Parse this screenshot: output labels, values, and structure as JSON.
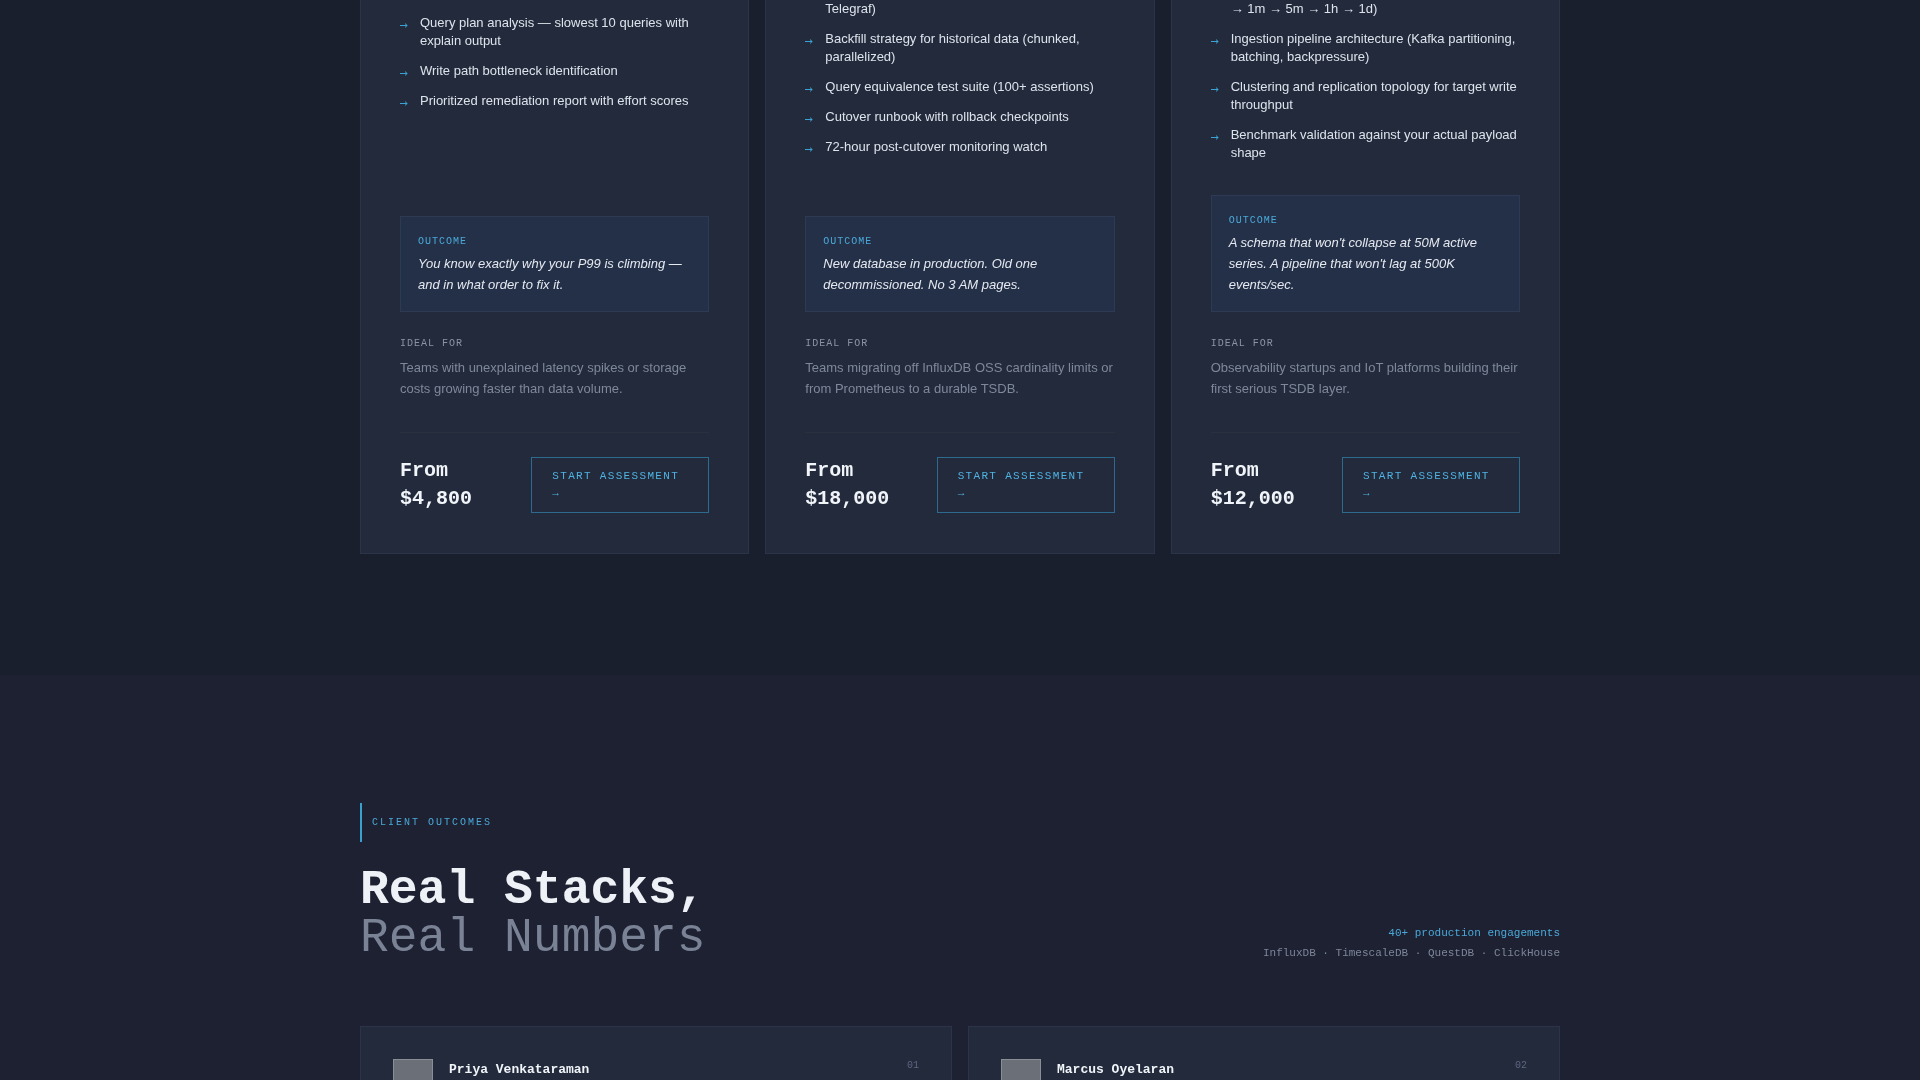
{
  "pricing_cards": [
    {
      "deliverables": [
        "Query plan analysis — slowest 10 queries with explain output",
        "Write path bottleneck identification",
        "Prioritized remediation report with effort scores"
      ],
      "outcome": {
        "label": "OUTCOME",
        "text": "You know exactly why your P99 is climbing — and in what order to fix it."
      },
      "ideal_for": {
        "label": "IDEAL FOR",
        "text": "Teams with unexplained latency spikes or storage costs growing faster than data volume."
      },
      "price": {
        "prefix": "From",
        "amount": "$4,800"
      },
      "button": "START ASSESSMENT →"
    },
    {
      "top_fragment": "Telegraf)",
      "deliverables": [
        "Backfill strategy for historical data (chunked, parallelized)",
        "Query equivalence test suite (100+ assertions)",
        "Cutover runbook with rollback checkpoints",
        "72-hour post-cutover monitoring watch"
      ],
      "outcome": {
        "label": "OUTCOME",
        "text": "New database in production. Old one decommissioned. No 3 AM pages."
      },
      "ideal_for": {
        "label": "IDEAL FOR",
        "text": "Teams migrating off InfluxDB OSS cardinality limits or from Prometheus to a durable TSDB."
      },
      "price": {
        "prefix": "From",
        "amount": "$18,000"
      },
      "button": "START ASSESSMENT →"
    },
    {
      "top_fragment": "→ 1m → 5m → 1h → 1d)",
      "deliverables": [
        "Ingestion pipeline architecture (Kafka partitioning, batching, backpressure)",
        "Clustering and replication topology for target write throughput",
        "Benchmark validation against your actual payload shape"
      ],
      "outcome": {
        "label": "OUTCOME",
        "text": "A schema that won't collapse at 50M active series. A pipeline that won't lag at 500K events/sec."
      },
      "ideal_for": {
        "label": "IDEAL FOR",
        "text": "Observability startups and IoT platforms building their first serious TSDB layer."
      },
      "price": {
        "prefix": "From",
        "amount": "$12,000"
      },
      "button": "START ASSESSMENT →"
    }
  ],
  "client_outcomes": {
    "eyebrow": "CLIENT OUTCOMES",
    "title": {
      "line_1": "Real Stacks,",
      "line_2": "Real Numbers"
    },
    "stat": "40+ production engagements",
    "databases": "InfluxDB · TimescaleDB · QuestDB · ClickHouse",
    "testimonials": [
      {
        "name": "Priya Venkataraman",
        "index": "01"
      },
      {
        "name": "Marcus Oyelaran",
        "index": "02"
      }
    ]
  }
}
